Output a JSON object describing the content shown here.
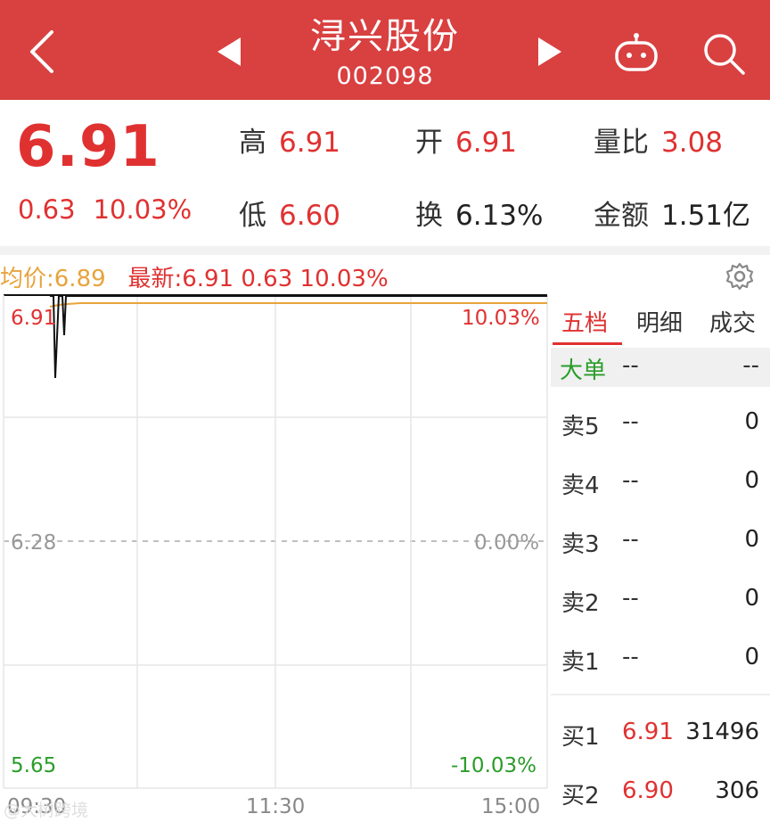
{
  "header": {
    "title": "浔兴股份",
    "code": "002098",
    "icons": [
      "back-icon",
      "prev-icon",
      "next-icon",
      "robot-icon",
      "search-icon"
    ]
  },
  "quote": {
    "price": "6.91",
    "change": "0.63",
    "change_pct": "10.03%",
    "high_label": "高",
    "high": "6.91",
    "low_label": "低",
    "low": "6.60",
    "open_label": "开",
    "open": "6.91",
    "turnover_label": "换",
    "turnover": "6.13%",
    "vol_ratio_label": "量比",
    "vol_ratio": "3.08",
    "amount_label": "金额",
    "amount": "1.51亿"
  },
  "chart_info": {
    "avg": "均价:6.89",
    "latest": "最新:6.91 0.63 10.03%"
  },
  "chart_data": {
    "type": "line",
    "x_ticks": [
      "09:30",
      "11:30",
      "15:00"
    ],
    "y_left": [
      "6.91",
      "6.28",
      "5.65"
    ],
    "y_right": [
      "10.03%",
      "0.00%",
      "-10.03%"
    ],
    "ylim": [
      5.65,
      6.91
    ],
    "series": [
      {
        "values": [
          6.91,
          6.62,
          6.91,
          6.91,
          6.8,
          6.91,
          6.91
        ]
      },
      {
        "values": [
          6.87,
          6.88,
          6.89,
          6.89,
          6.89
        ]
      }
    ]
  },
  "panel": {
    "tabs": [
      "五档",
      "明细",
      "成交"
    ],
    "big": {
      "label": "大单",
      "a": "--",
      "b": "--"
    },
    "asks": [
      {
        "label": "卖5",
        "price": "--",
        "vol": "0"
      },
      {
        "label": "卖4",
        "price": "--",
        "vol": "0"
      },
      {
        "label": "卖3",
        "price": "--",
        "vol": "0"
      },
      {
        "label": "卖2",
        "price": "--",
        "vol": "0"
      },
      {
        "label": "卖1",
        "price": "--",
        "vol": "0"
      }
    ],
    "bids": [
      {
        "label": "买1",
        "price": "6.91",
        "vol": "31496"
      },
      {
        "label": "买2",
        "price": "6.90",
        "vol": "306"
      }
    ]
  },
  "colors": {
    "red": "#e03131",
    "header": "#d94040",
    "avg": "#e8a33d",
    "green": "#2a9d2a"
  },
  "watermark": "@大树跨境"
}
